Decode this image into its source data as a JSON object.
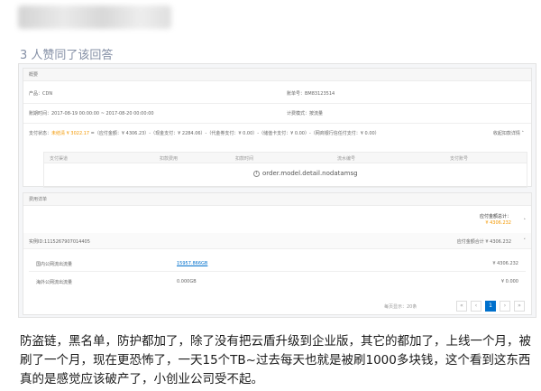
{
  "answer": {
    "upvote_text": "3 人赞同了该回答",
    "body": "防盗链，黑名单，防护都加了，除了没有把云盾升级到企业版，其它的都加了，上线一个月，被刷了一个月，现在更恐怖了，一天15个TB~过去每天也就是被刷1000多块钱，这个看到这东西真的是感觉应该破产了，小创业公司受不起。"
  },
  "screenshot": {
    "overview": {
      "title": "概要",
      "product": "产品：CDN",
      "account": "账单号：BM83123514",
      "period": "账期时间：2017-08-19 00:00:00 ~ 2017-08-20 00:00:00",
      "billing_mode": "计费模式：按流量",
      "pay_status_label": "支付状态：",
      "pay_status_value": "未结清",
      "pay_amount": "¥ 3022.17",
      "pay_breakdown": "=（应付金额：¥ 4306.23）-（现金支付：¥ 2284.06）-（代金券支付：¥ 0.00）-（储值卡支付：¥ 0.00）-（网商银行信任付支付：¥ 0.00）",
      "collapse_link": "收起扣款详情",
      "table_headers": [
        "支付渠道",
        "扣款费用",
        "扣款时间",
        "流水编号",
        "支付账号"
      ],
      "no_data": "order.model.detail.nodatamsg"
    },
    "detail": {
      "title": "费用详单",
      "total_label": "应付金额总计：",
      "total_value": "¥ 4306.232",
      "instance_id": "实例ID:1115267907014405",
      "instance_total": "应付金额合计 ¥ 4306.232",
      "rows": [
        {
          "name": "国内公网流出流量",
          "usage": "15957.866GB",
          "amount": "¥ 4306.232"
        },
        {
          "name": "海外公网流出流量",
          "usage": "0.000GB",
          "amount": "¥ 0.000"
        }
      ],
      "pagination": {
        "per_page_text": "每页显示：20条",
        "pages": [
          "«",
          "‹",
          "1",
          "›",
          "»"
        ]
      }
    }
  }
}
